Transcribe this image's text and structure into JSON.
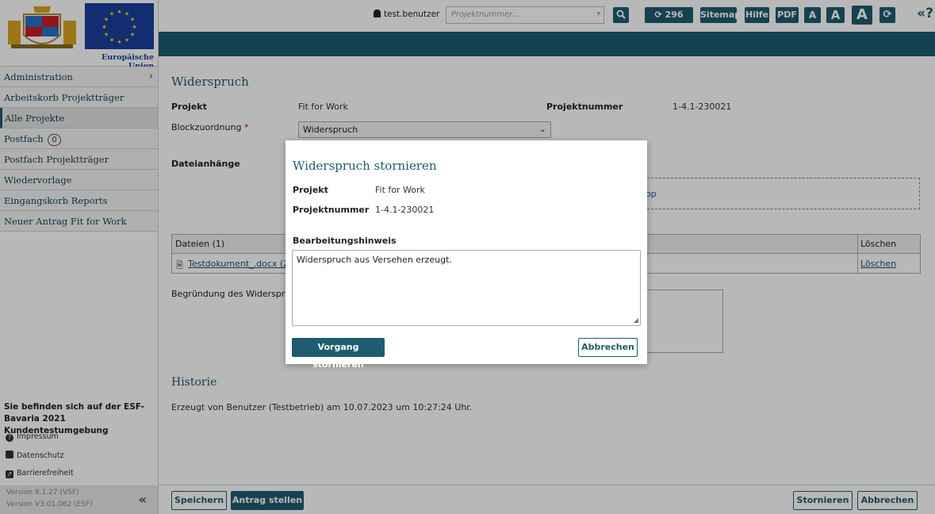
{
  "sidebar": {
    "eu_label": "Europäische Union",
    "items": [
      {
        "label": "Administration",
        "chevron": "›"
      },
      {
        "label": "Arbeitskorb Projektträger"
      },
      {
        "label": "Alle Projekte"
      },
      {
        "label": "Postfach",
        "badge": "0"
      },
      {
        "label": "Postfach Projektträger"
      },
      {
        "label": "Wiedervorlage"
      },
      {
        "label": "Eingangskorb Reports"
      },
      {
        "label": "Neuer Antrag Fit for Work"
      }
    ],
    "env_info": "Sie befinden sich auf der ESF-Bavaria 2021 Kundentestumgebung",
    "links": [
      "Impressum",
      "Datenschutz",
      "Barrierefreiheit"
    ],
    "versions": [
      "Version 8.1.27 (VSF)",
      "Version V3.01.062 (ESF)"
    ],
    "collapse_icon": "«"
  },
  "topbar": {
    "username": "test.benutzer",
    "project_placeholder": "Projektnummer...",
    "timer": "296 min",
    "buttons": [
      "Sitemap",
      "Hilfe",
      "PDF",
      "A",
      "A",
      "A"
    ],
    "help_icon": "«?"
  },
  "main": {
    "title": "Widerspruch",
    "projekt_label": "Projekt",
    "projekt_value": "Fit for Work",
    "projektnummer_label": "Projektnummer",
    "projektnummer_value": "1-4.1-230021",
    "block_label": "Blockzuordnung",
    "block_required": "*",
    "block_value": "Widerspruch",
    "attachments_label": "Dateianhänge",
    "drop_text": "op",
    "files_header": "Dateien (1)",
    "delete_header": "Löschen",
    "file_name": "Testdokument_.docx (Zul",
    "delete_link": "Löschen",
    "reason_label": "Begründung des Widerspruch",
    "history_title": "Historie",
    "history_entry": "Erzeugt von Benutzer (Testbetrieb) am 10.07.2023 um 10:27:24 Uhr."
  },
  "footer": {
    "save": "Speichern",
    "submit": "Antrag stellen",
    "cancel_process": "Stornieren",
    "abort": "Abbrechen"
  },
  "modal": {
    "title": "Widerspruch stornieren",
    "projekt_label": "Projekt",
    "projekt_value": "Fit for Work",
    "projektnummer_label": "Projektnummer",
    "projektnummer_value": "1-4.1-230021",
    "hint_label": "Bearbeitungshinweis",
    "hint_value": "Widerspruch aus Versehen erzeugt.",
    "confirm": "Vorgang stornieren",
    "cancel": "Abbrechen"
  },
  "colors": {
    "accent": "#1e5c70",
    "eu_blue": "#1a3f9e"
  }
}
